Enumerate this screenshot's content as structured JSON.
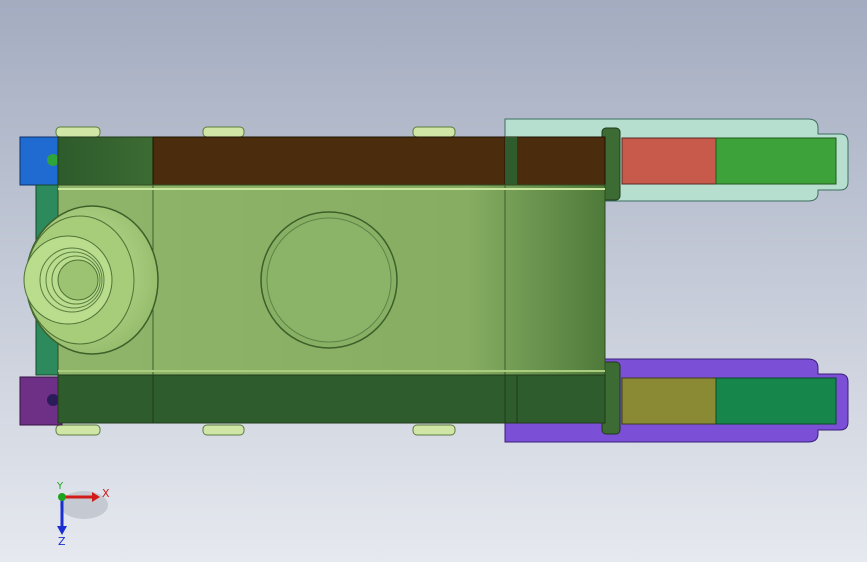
{
  "viewport": {
    "background_top": "#a3acc0",
    "background_bottom": "#e6e9ef"
  },
  "model": {
    "colors": {
      "body_green": "#8fb56a",
      "body_light": "#b7d88a",
      "body_dark": "#2f5c2c",
      "brown": "#4b2c0d",
      "teal_frame": "#9fd1c0",
      "blue_part": "#1f6bd1",
      "purple_part": "#6e2f87",
      "salmon": "#c85a4b",
      "bright_green": "#3ea23a",
      "violet_frame": "#6a35c8",
      "olive": "#8a8a34",
      "sea_green": "#16864a"
    }
  },
  "triad": {
    "x_label": "X",
    "y_label": "Y",
    "z_label": "Z",
    "x_color": "#d11b1b",
    "y_color": "#1ea31e",
    "z_color": "#1b2ed1"
  }
}
